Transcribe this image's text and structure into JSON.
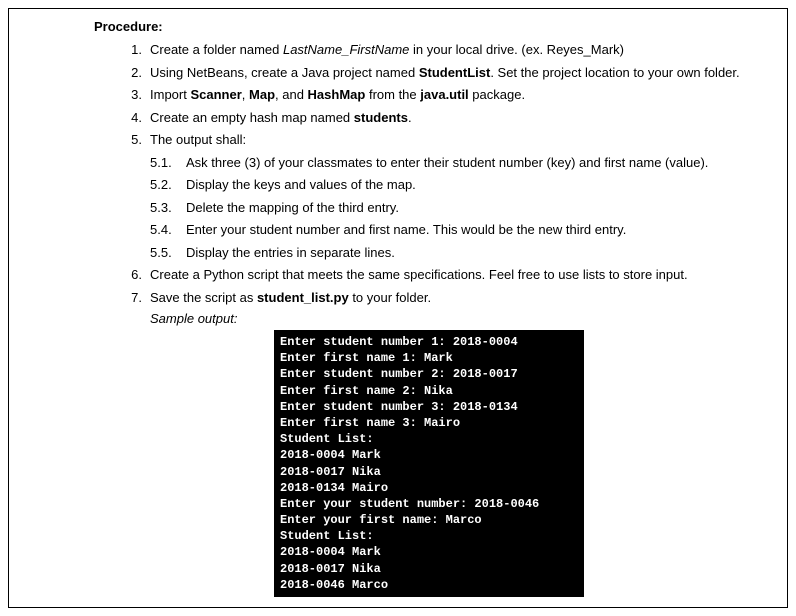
{
  "heading": "Procedure:",
  "items": {
    "n1": "1.",
    "t1a": "Create a folder named ",
    "t1b": "LastName_FirstName",
    "t1c": " in your local drive. (ex. Reyes_Mark)",
    "n2": "2.",
    "t2a": "Using NetBeans, create a Java project named ",
    "t2b": "StudentList",
    "t2c": ". Set the project location to your own folder.",
    "n3": "3.",
    "t3a": "Import ",
    "t3b": "Scanner",
    "t3c": ", ",
    "t3d": "Map",
    "t3e": ", and ",
    "t3f": "HashMap",
    "t3g": " from the ",
    "t3h": "java.util",
    "t3i": " package.",
    "n4": "4.",
    "t4a": "Create an empty hash map named ",
    "t4b": "students",
    "t4c": ".",
    "n5": "5.",
    "t5": "The output shall:",
    "sn51": "5.1.",
    "st51": "Ask three (3) of your classmates to enter their student number (key) and first name (value).",
    "sn52": "5.2.",
    "st52": "Display the keys and values of the map.",
    "sn53": "5.3.",
    "st53": "Delete the mapping of the third entry.",
    "sn54": "5.4.",
    "st54": "Enter your student number and first name. This would be the new third entry.",
    "sn55": "5.5.",
    "st55": "Display the entries in separate lines.",
    "n6": "6.",
    "t6": "Create a Python script that meets the same specifications. Feel free to use lists to store input.",
    "n7": "7.",
    "t7a": "Save the script as ",
    "t7b": "student_list.py",
    "t7c": " to your folder."
  },
  "sampleLabel": "Sample output:",
  "terminal": "Enter student number 1: 2018-0004\nEnter first name 1: Mark\nEnter student number 2: 2018-0017\nEnter first name 2: Nika\nEnter student number 3: 2018-0134\nEnter first name 3: Mairo\nStudent List:\n2018-0004 Mark\n2018-0017 Nika\n2018-0134 Mairo\nEnter your student number: 2018-0046\nEnter your first name: Marco\nStudent List:\n2018-0004 Mark\n2018-0017 Nika\n2018-0046 Marco"
}
